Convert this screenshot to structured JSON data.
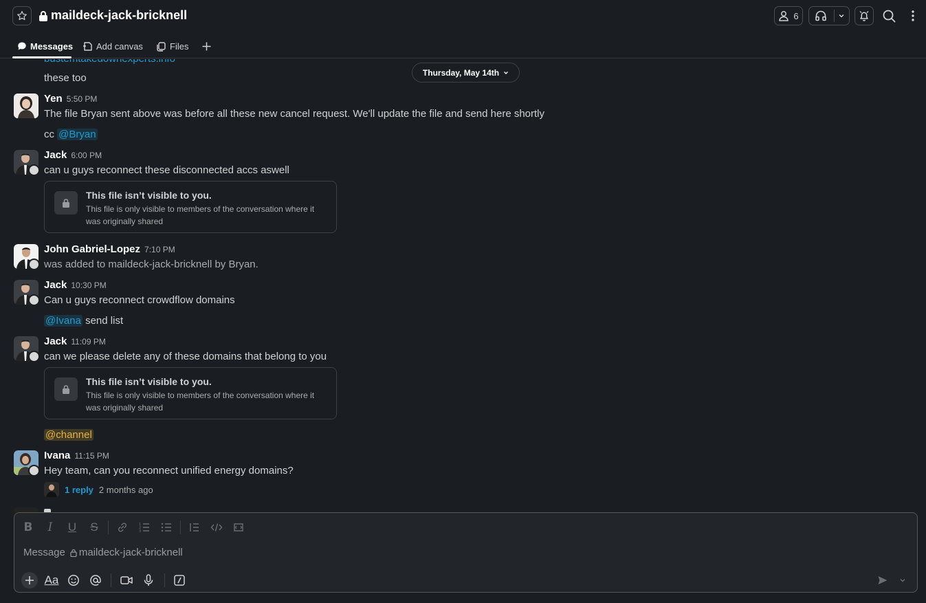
{
  "header": {
    "channel_name": "maildeck-jack-bricknell",
    "member_count": "6"
  },
  "tabs": [
    {
      "label": "Messages"
    },
    {
      "label": "Add canvas"
    },
    {
      "label": "Files"
    }
  ],
  "date_divider": "Thursday, May 14th",
  "messages": {
    "cut_link": "bustemtakedownexperts.info",
    "these_too": "these too",
    "m1": {
      "name": "Yen",
      "time": "5:50 PM",
      "text": "The file Bryan sent above was before all these new cancel request. We'll update the file and send here shortly",
      "cc": "cc",
      "mention": "@Bryan"
    },
    "m2": {
      "name": "Jack",
      "time": "6:00 PM",
      "text": "can u guys reconnect these disconnected accs aswell"
    },
    "file_hidden": {
      "title": "This file isn’t visible to you.",
      "sub": "This file is only visible to members of the conversation where it was originally shared"
    },
    "m3": {
      "name": "John Gabriel-Lopez",
      "time": "7:10 PM",
      "text": "was added to maildeck-jack-bricknell by Bryan."
    },
    "m4": {
      "name": "Jack",
      "time": "10:30 PM",
      "text": "Can u guys reconnect crowdflow domains",
      "mention": "@Ivana",
      "followup": "send list"
    },
    "m5": {
      "name": "Jack",
      "time": "11:09 PM",
      "text": "can we please delete any of these domains that belong to you",
      "channel_mention": "@channel"
    },
    "m6": {
      "name": "Ivana",
      "time": "11:15 PM",
      "text": "Hey team, can  you reconnect unified energy domains?",
      "reply_count": "1 reply",
      "reply_time": "2 months ago"
    }
  },
  "composer": {
    "placeholder_prefix": "Message",
    "placeholder_channel": "maildeck-jack-bricknell"
  },
  "colors": {
    "accent": "#1d9bd1",
    "channel_mention": "#e8b23a",
    "background": "#1a1d21"
  }
}
